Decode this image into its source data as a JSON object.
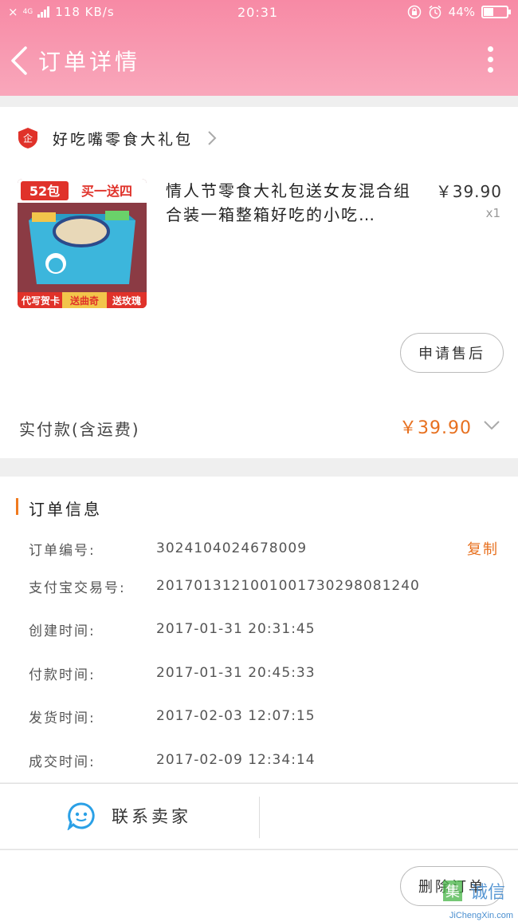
{
  "status_bar": {
    "signal": "×",
    "network": "4G",
    "speed": "118 KB/s",
    "time": "20:31",
    "battery_pct": "44%",
    "battery_level": 0.44
  },
  "header": {
    "title": "订单详情"
  },
  "shop": {
    "badge_text": "企",
    "name": "好吃嘴零食大礼包"
  },
  "product": {
    "image_banner": "52包 买一送四",
    "image_footer": "代写贺卡送曲奇送玫瑰",
    "title": "情人节零食大礼包送女友混合组合装一箱整箱好吃的小吃…",
    "price": "￥39.90",
    "quantity": "x1"
  },
  "actions": {
    "after_sale": "申请售后",
    "delete_order": "删除订单"
  },
  "payment": {
    "label": "实付款(含运费)",
    "amount": "￥39.90"
  },
  "order_info": {
    "section_title": "订单信息",
    "copy_label": "复制",
    "rows": [
      {
        "label": "订单编号:",
        "value": "3024104024678009"
      },
      {
        "label": "支付宝交易号:",
        "value": "2017013121001001730298081240"
      },
      {
        "label": "创建时间:",
        "value": "2017-01-31  20:31:45"
      },
      {
        "label": "付款时间:",
        "value": "2017-01-31  20:45:33"
      },
      {
        "label": "发货时间:",
        "value": "2017-02-03  12:07:15"
      },
      {
        "label": "成交时间:",
        "value": "2017-02-09  12:34:14"
      }
    ]
  },
  "contact": {
    "label": "联系卖家"
  },
  "watermark": {
    "text": "JiChengXin.com"
  },
  "colors": {
    "header_pink": "#f78aa5",
    "accent_orange": "#e7701f",
    "shop_red": "#e0322a"
  }
}
